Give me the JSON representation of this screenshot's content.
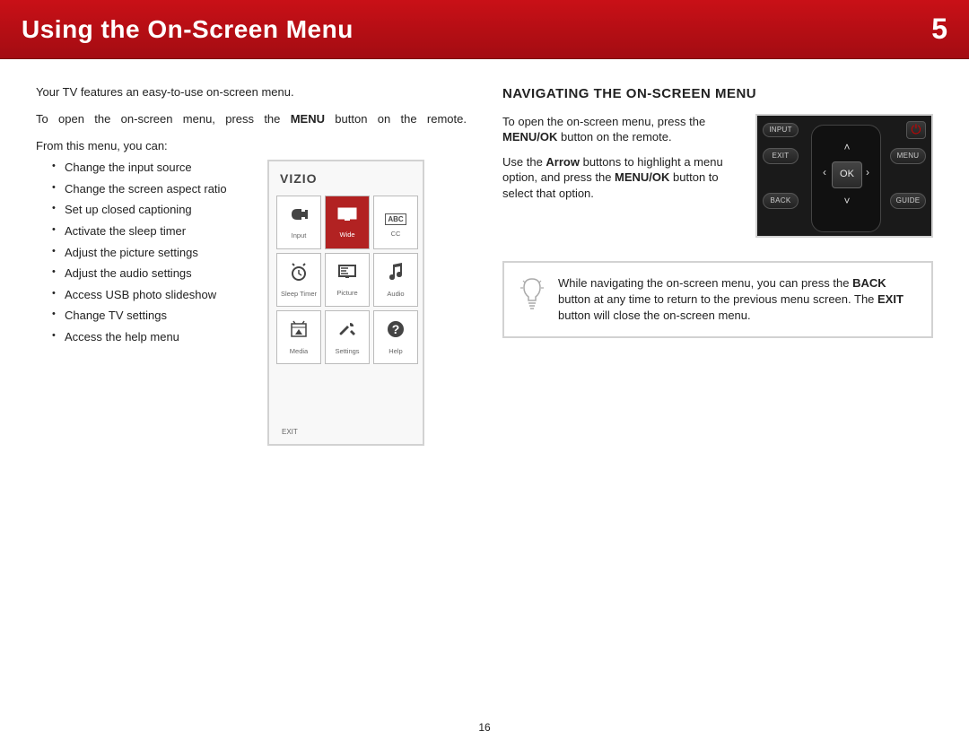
{
  "header": {
    "title": "Using the On-Screen Menu",
    "chapter": "5"
  },
  "left": {
    "intro1": "Your TV features an easy-to-use on-screen menu.",
    "intro2a": "To open the on-screen menu, press the ",
    "intro2b": "MENU",
    "intro2c": " button on the remote.",
    "from": "From this menu, you can:",
    "bullets": [
      "Change the input source",
      "Change the screen aspect ratio",
      "Set up closed captioning",
      "Activate the sleep timer",
      "Adjust the picture settings",
      "Adjust the audio settings",
      "Access USB photo slideshow",
      "Change TV settings",
      "Access the help menu"
    ]
  },
  "menu": {
    "logo": "VIZIO",
    "cells": [
      {
        "label": "Input"
      },
      {
        "label": "Wide"
      },
      {
        "label": "CC"
      },
      {
        "label": "Sleep Timer"
      },
      {
        "label": "Picture"
      },
      {
        "label": "Audio"
      },
      {
        "label": "Media"
      },
      {
        "label": "Settings"
      },
      {
        "label": "Help"
      }
    ],
    "exit": "EXIT"
  },
  "right": {
    "heading": "NAVIGATING THE ON-SCREEN MENU",
    "p1a": "To open the on-screen menu, press the ",
    "p1b": "MENU/OK",
    "p1c": " button on the remote.",
    "p2a": "Use the ",
    "p2b": "Arrow",
    "p2c": " buttons to highlight a menu option, and press the ",
    "p2d": "MENU/OK",
    "p2e": " button to select that option."
  },
  "remote": {
    "input": "INPUT",
    "exit": "EXIT",
    "back": "BACK",
    "menu": "MENU",
    "guide": "GUIDE",
    "ok": "OK"
  },
  "tip": {
    "t1": "While navigating the on-screen menu, you can press the ",
    "t2": "BACK",
    "t3": " button at any time to return to the previous menu screen. The ",
    "t4": "EXIT",
    "t5": " button will close the on-screen menu."
  },
  "page": "16"
}
